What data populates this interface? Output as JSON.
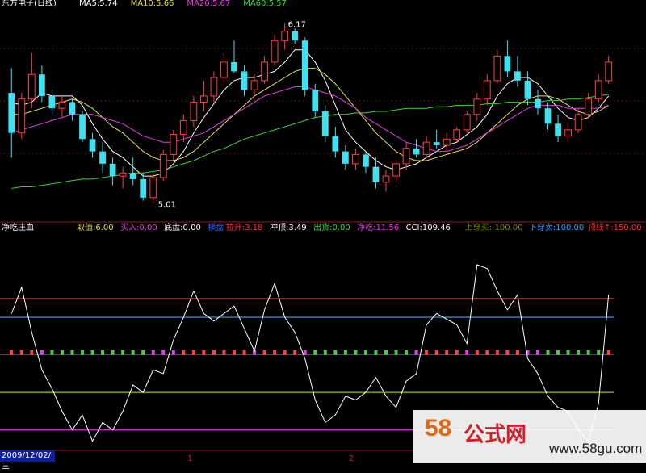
{
  "top_panel": {
    "title": "东方电子(日线)",
    "ma": [
      {
        "label": "MA5:5.74",
        "color": "#ffffff"
      },
      {
        "label": "MA10:5.66",
        "color": "#e8e050"
      },
      {
        "label": "MA20:5.67",
        "color": "#e040e0"
      },
      {
        "label": "MA60:5.57",
        "color": "#40d040"
      }
    ],
    "high_marker": "6.17",
    "low_marker": "5.01"
  },
  "bottom_panel": {
    "title": "净吃庄血",
    "indicators": [
      {
        "label": "取值:6.00",
        "color": "#e8e050"
      },
      {
        "label": "买入:0.00",
        "color": "#e040e0"
      },
      {
        "label": "底盘:0.00",
        "color": "#ffffff"
      },
      {
        "label": "横盘",
        "color": "#3060ff"
      },
      {
        "label": "拉升:3.18",
        "color": "#ff3030"
      },
      {
        "label": "冲顶:3.49",
        "color": "#ffffff"
      },
      {
        "label": "出货:0.00",
        "color": "#40d040"
      },
      {
        "label": "净吃:11.56",
        "color": "#e040e0"
      },
      {
        "label": "CCI:109.46",
        "color": "#ffffff"
      },
      {
        "label": "上穿买:-100.00",
        "color": "#808000"
      },
      {
        "label": "下穿卖:100.00",
        "color": "#3da0ff"
      },
      {
        "label": "顶线↑:150.00",
        "color": "#ff3030"
      },
      {
        "label": "底线",
        "color": "#e040e0"
      }
    ]
  },
  "x_axis": {
    "date_label": "2009/12/02/三",
    "ticks": [
      "1",
      "2"
    ]
  },
  "watermark": {
    "number": "58",
    "name": "公式网",
    "url": "www.58gu.com"
  },
  "colors": {
    "up": "#ff4040",
    "down": "#40e0f0",
    "ma5": "#ffffff",
    "ma10": "#e8e050",
    "ma20": "#e040e0",
    "ma60": "#40d040",
    "cci": "#ffffff",
    "line_top": "#d01818",
    "line_upper": "#3d7fd0",
    "line_lower": "#a0a020",
    "line_bottom": "#d030d0",
    "grid": "#8b1a1a"
  },
  "chart_data": [
    {
      "type": "candlestick",
      "title": "东方电子(日线)",
      "ylim": [
        4.95,
        6.25
      ],
      "candles": [
        [
          5.72,
          5.88,
          5.3,
          5.46
        ],
        [
          5.46,
          5.72,
          5.42,
          5.68
        ],
        [
          5.68,
          5.98,
          5.62,
          5.84
        ],
        [
          5.84,
          5.9,
          5.66,
          5.7
        ],
        [
          5.7,
          5.74,
          5.58,
          5.62
        ],
        [
          5.62,
          5.7,
          5.56,
          5.66
        ],
        [
          5.66,
          5.68,
          5.54,
          5.58
        ],
        [
          5.58,
          5.6,
          5.4,
          5.42
        ],
        [
          5.42,
          5.46,
          5.3,
          5.34
        ],
        [
          5.34,
          5.4,
          5.2,
          5.26
        ],
        [
          5.26,
          5.3,
          5.12,
          5.18
        ],
        [
          5.18,
          5.24,
          5.1,
          5.2
        ],
        [
          5.2,
          5.3,
          5.12,
          5.16
        ],
        [
          5.16,
          5.2,
          5.02,
          5.04
        ],
        [
          5.04,
          5.2,
          5.0,
          5.17
        ],
        [
          5.17,
          5.35,
          5.15,
          5.32
        ],
        [
          5.32,
          5.48,
          5.28,
          5.45
        ],
        [
          5.45,
          5.58,
          5.4,
          5.54
        ],
        [
          5.54,
          5.7,
          5.5,
          5.66
        ],
        [
          5.66,
          5.8,
          5.6,
          5.7
        ],
        [
          5.7,
          5.86,
          5.66,
          5.82
        ],
        [
          5.82,
          5.98,
          5.78,
          5.92
        ],
        [
          5.92,
          6.06,
          5.85,
          5.86
        ],
        [
          5.86,
          5.9,
          5.7,
          5.74
        ],
        [
          5.74,
          5.84,
          5.7,
          5.8
        ],
        [
          5.8,
          5.96,
          5.78,
          5.92
        ],
        [
          5.92,
          6.1,
          5.9,
          6.06
        ],
        [
          6.06,
          6.17,
          6.0,
          6.12
        ],
        [
          6.12,
          6.14,
          6.04,
          6.06
        ],
        [
          6.06,
          6.08,
          5.7,
          5.74
        ],
        [
          5.74,
          5.78,
          5.56,
          5.6
        ],
        [
          5.6,
          5.64,
          5.4,
          5.44
        ],
        [
          5.44,
          5.5,
          5.3,
          5.34
        ],
        [
          5.34,
          5.38,
          5.22,
          5.26
        ],
        [
          5.26,
          5.36,
          5.22,
          5.32
        ],
        [
          5.32,
          5.34,
          5.2,
          5.24
        ],
        [
          5.24,
          5.3,
          5.1,
          5.14
        ],
        [
          5.14,
          5.22,
          5.08,
          5.18
        ],
        [
          5.18,
          5.28,
          5.14,
          5.26
        ],
        [
          5.26,
          5.4,
          5.22,
          5.36
        ],
        [
          5.36,
          5.42,
          5.3,
          5.32
        ],
        [
          5.32,
          5.44,
          5.3,
          5.4
        ],
        [
          5.4,
          5.48,
          5.36,
          5.38
        ],
        [
          5.38,
          5.46,
          5.34,
          5.42
        ],
        [
          5.42,
          5.5,
          5.4,
          5.48
        ],
        [
          5.48,
          5.6,
          5.46,
          5.58
        ],
        [
          5.58,
          5.72,
          5.54,
          5.68
        ],
        [
          5.68,
          5.84,
          5.64,
          5.8
        ],
        [
          5.8,
          6.0,
          5.78,
          5.96
        ],
        [
          5.96,
          6.06,
          5.82,
          5.86
        ],
        [
          5.86,
          5.96,
          5.76,
          5.8
        ],
        [
          5.8,
          5.86,
          5.64,
          5.68
        ],
        [
          5.68,
          5.74,
          5.58,
          5.62
        ],
        [
          5.62,
          5.66,
          5.48,
          5.52
        ],
        [
          5.52,
          5.58,
          5.4,
          5.44
        ],
        [
          5.44,
          5.52,
          5.4,
          5.48
        ],
        [
          5.48,
          5.62,
          5.46,
          5.58
        ],
        [
          5.58,
          5.72,
          5.56,
          5.68
        ],
        [
          5.68,
          5.84,
          5.66,
          5.8
        ],
        [
          5.8,
          5.96,
          5.78,
          5.92
        ]
      ],
      "ma_series": [
        {
          "name": "MA5",
          "values": [
            5.66,
            5.64,
            5.66,
            5.72,
            5.7,
            5.7,
            5.7,
            5.64,
            5.52,
            5.42,
            5.34,
            5.3,
            5.24,
            5.18,
            5.18,
            5.2,
            5.26,
            5.34,
            5.46,
            5.56,
            5.65,
            5.74,
            5.8,
            5.82,
            5.82,
            5.84,
            5.86,
            5.92,
            6.0,
            6.0,
            5.92,
            5.8,
            5.64,
            5.48,
            5.4,
            5.34,
            5.28,
            5.24,
            5.22,
            5.24,
            5.26,
            5.3,
            5.34,
            5.38,
            5.4,
            5.45,
            5.5,
            5.58,
            5.7,
            5.78,
            5.82,
            5.82,
            5.78,
            5.7,
            5.62,
            5.56,
            5.54,
            5.56,
            5.62,
            5.7
          ]
        },
        {
          "name": "MA10",
          "values": [
            5.58,
            5.58,
            5.6,
            5.62,
            5.64,
            5.66,
            5.68,
            5.66,
            5.62,
            5.56,
            5.5,
            5.46,
            5.4,
            5.34,
            5.3,
            5.28,
            5.28,
            5.3,
            5.34,
            5.4,
            5.46,
            5.52,
            5.58,
            5.64,
            5.7,
            5.74,
            5.78,
            5.82,
            5.86,
            5.88,
            5.88,
            5.84,
            5.78,
            5.7,
            5.62,
            5.54,
            5.46,
            5.4,
            5.34,
            5.3,
            5.28,
            5.28,
            5.3,
            5.32,
            5.34,
            5.36,
            5.4,
            5.46,
            5.52,
            5.58,
            5.64,
            5.68,
            5.7,
            5.7,
            5.68,
            5.64,
            5.6,
            5.58,
            5.6,
            5.64
          ]
        },
        {
          "name": "MA20",
          "values": [
            5.46,
            5.48,
            5.5,
            5.52,
            5.54,
            5.56,
            5.58,
            5.58,
            5.58,
            5.56,
            5.54,
            5.52,
            5.48,
            5.44,
            5.42,
            5.4,
            5.4,
            5.42,
            5.44,
            5.46,
            5.5,
            5.54,
            5.58,
            5.62,
            5.66,
            5.7,
            5.72,
            5.74,
            5.76,
            5.76,
            5.74,
            5.72,
            5.7,
            5.66,
            5.62,
            5.56,
            5.52,
            5.48,
            5.44,
            5.4,
            5.38,
            5.36,
            5.34,
            5.34,
            5.36,
            5.38,
            5.42,
            5.46,
            5.5,
            5.54,
            5.58,
            5.62,
            5.64,
            5.64,
            5.64,
            5.62,
            5.62,
            5.62,
            5.62,
            5.64
          ]
        },
        {
          "name": "MA60",
          "values": [
            5.1,
            5.11,
            5.11,
            5.12,
            5.13,
            5.14,
            5.15,
            5.16,
            5.16,
            5.17,
            5.18,
            5.19,
            5.2,
            5.2,
            5.21,
            5.22,
            5.24,
            5.26,
            5.28,
            5.31,
            5.34,
            5.36,
            5.39,
            5.42,
            5.44,
            5.46,
            5.48,
            5.5,
            5.52,
            5.54,
            5.56,
            5.57,
            5.58,
            5.58,
            5.59,
            5.59,
            5.6,
            5.6,
            5.61,
            5.62,
            5.62,
            5.62,
            5.63,
            5.63,
            5.64,
            5.64,
            5.64,
            5.65,
            5.65,
            5.66,
            5.66,
            5.66,
            5.66,
            5.67,
            5.67,
            5.68,
            5.68,
            5.69,
            5.7,
            5.71
          ]
        }
      ]
    },
    {
      "type": "line",
      "title": "净吃庄血",
      "ylim": [
        -250,
        300
      ],
      "reference_lines": [
        {
          "name": "顶线",
          "value": 150
        },
        {
          "name": "下穿卖",
          "value": 100
        },
        {
          "name": "上穿买",
          "value": -100
        },
        {
          "name": "底线",
          "value": -200
        }
      ],
      "series": [
        {
          "name": "CCI",
          "values": [
            110,
            180,
            60,
            -40,
            -90,
            -150,
            -200,
            -160,
            -230,
            -180,
            -200,
            -150,
            -80,
            -100,
            -40,
            -50,
            40,
            100,
            170,
            110,
            90,
            110,
            130,
            70,
            10,
            120,
            190,
            100,
            60,
            -10,
            -120,
            -180,
            -160,
            -110,
            -120,
            -100,
            -60,
            -110,
            -140,
            -70,
            -50,
            80,
            110,
            95,
            80,
            30,
            240,
            230,
            170,
            120,
            160,
            -10,
            -50,
            -110,
            -140,
            -150,
            -200,
            -230,
            -130,
            160
          ]
        },
        {
          "name": "净吃",
          "values": [
            0,
            0,
            0,
            0,
            0,
            0,
            0,
            0,
            0,
            0,
            0,
            0,
            0,
            0,
            0,
            0,
            0,
            0,
            0,
            0,
            0,
            0,
            0,
            0,
            0,
            0,
            0,
            0,
            0,
            0,
            0,
            0,
            0,
            0,
            0,
            0,
            0,
            0,
            0,
            0,
            0,
            0,
            0,
            0,
            0,
            0,
            0,
            0,
            0,
            0,
            0,
            0,
            0,
            0,
            0,
            0,
            0,
            0,
            0,
            11.56
          ]
        }
      ]
    }
  ]
}
